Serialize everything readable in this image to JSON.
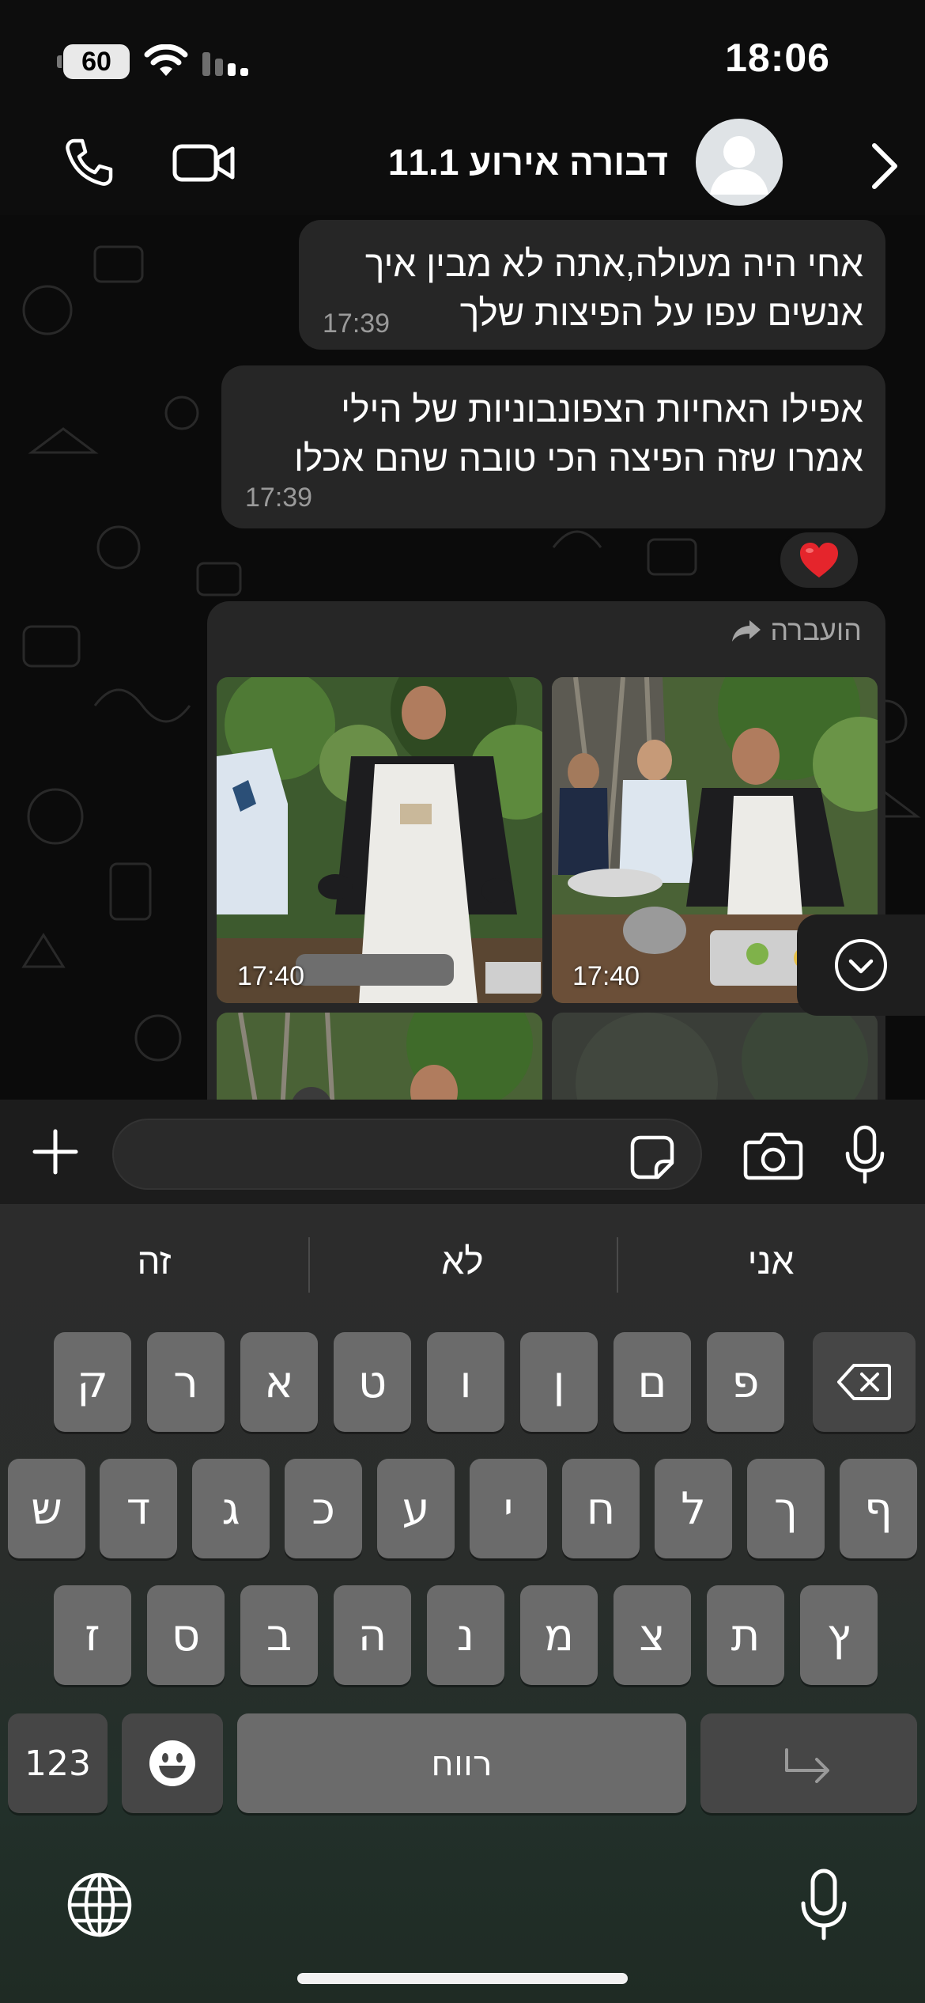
{
  "status_bar": {
    "battery": "60",
    "time": "18:06"
  },
  "header": {
    "contact_name": "דבורה אירוע 11.1"
  },
  "messages": [
    {
      "lines": [
        "אחי היה מעולה,אתה לא מבין איך",
        "אנשים עפו על הפיצות שלך"
      ],
      "time": "17:39"
    },
    {
      "lines": [
        "אפילו האחיות הצפונבוניות של הילי",
        "אמרו שזה הפיצה הכי טובה שהם אכלו"
      ],
      "time": "17:39",
      "reaction": "❤️"
    }
  ],
  "forwarded": {
    "label": "הועברה",
    "photos": [
      {
        "time": "17:40"
      },
      {
        "time": "17:40"
      }
    ]
  },
  "input": {
    "placeholder": ""
  },
  "keyboard": {
    "suggestions": [
      "אני",
      "לא",
      "זה"
    ],
    "row1": [
      "ק",
      "ר",
      "א",
      "ט",
      "ו",
      "ן",
      "ם",
      "פ"
    ],
    "row2": [
      "ש",
      "ד",
      "ג",
      "כ",
      "ע",
      "י",
      "ח",
      "ל",
      "ך",
      "ף"
    ],
    "row3": [
      "ז",
      "ס",
      "ב",
      "ה",
      "נ",
      "מ",
      "צ",
      "ת",
      "ץ"
    ],
    "numbers_label": "123",
    "space_label": "רווח"
  },
  "colors": {
    "bubble": "#262626",
    "heart": "#e5252c",
    "key": "#6b6b6b",
    "key_dark": "#464646"
  }
}
